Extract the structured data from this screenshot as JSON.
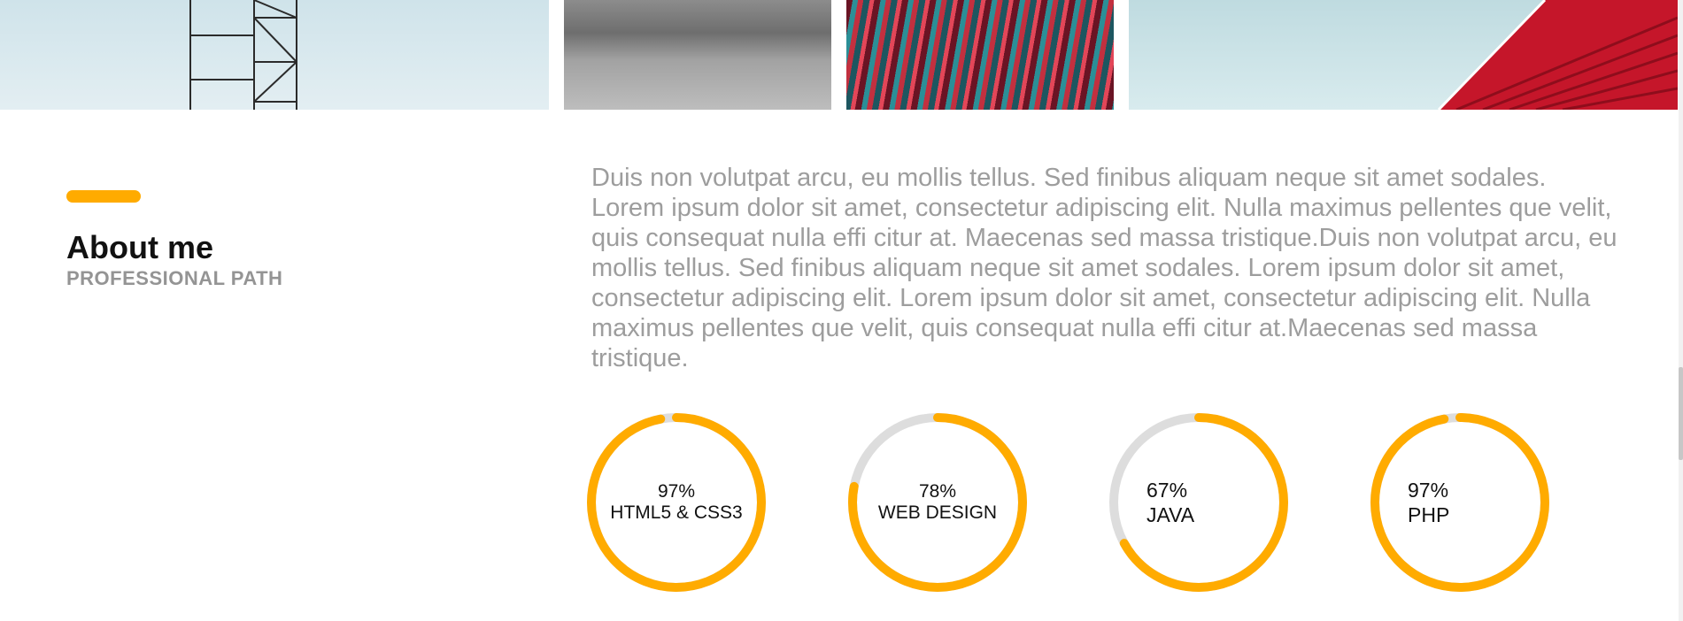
{
  "about": {
    "title": "About me",
    "subtitle": "PROFESSIONAL PATH",
    "text": "Duis non volutpat arcu, eu mollis tellus. Sed finibus aliquam neque sit amet sodales. Lorem ipsum dolor sit amet, consectetur adipiscing elit. Nulla maximus pellentes que velit, quis consequat nulla effi citur at. Maecenas sed massa tristique.Duis non volutpat arcu, eu mollis tellus. Sed finibus aliquam neque sit amet sodales. Lorem ipsum dolor sit amet, consectetur adipiscing elit. Lorem ipsum dolor sit amet, consectetur adipiscing elit. Nulla maximus pellentes que velit, quis consequat nulla effi citur at.Maecenas sed massa tristique."
  },
  "skills": [
    {
      "percent_label": "97%",
      "name": "HTML5 & CSS3",
      "value": 0.97
    },
    {
      "percent_label": "78%",
      "name": "WEB DESIGN",
      "value": 0.78
    },
    {
      "percent_label": "67%",
      "name": "JAVA",
      "value": 0.67
    },
    {
      "percent_label": "97%",
      "name": "PHP",
      "value": 0.97
    }
  ],
  "colors": {
    "accent": "#ffab00",
    "ring_track": "#dddddd",
    "body_text": "#9d9d9d",
    "subtitle": "#949494"
  }
}
